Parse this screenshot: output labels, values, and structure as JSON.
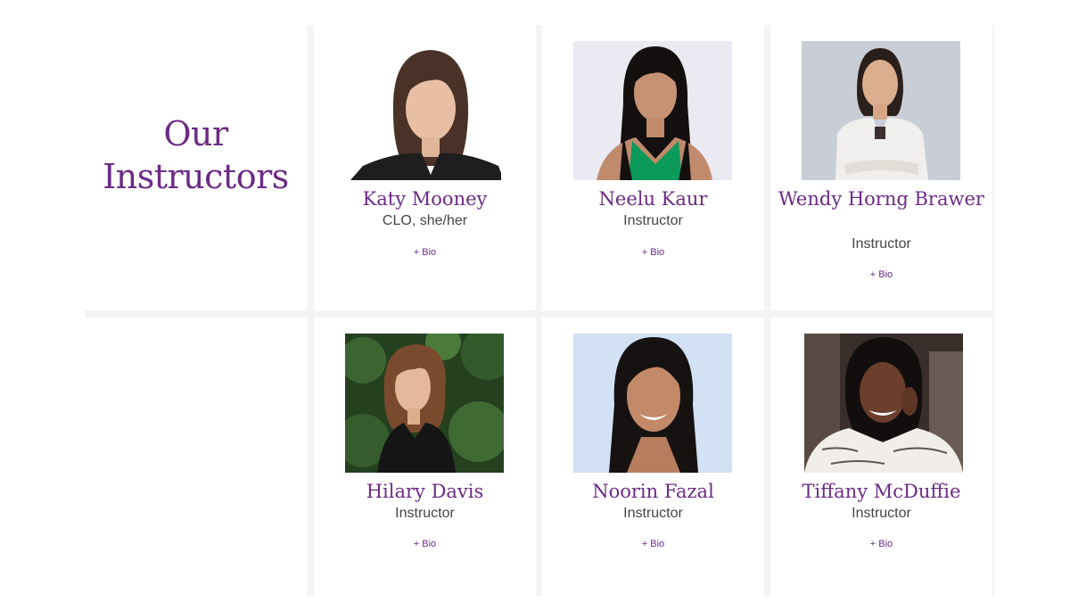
{
  "section": {
    "title_line1": "Our",
    "title_line2": "Instructors"
  },
  "instructors": [
    {
      "name": "Katy Mooney",
      "role": "CLO, she/her",
      "bio_label": "+ Bio"
    },
    {
      "name": "Neelu Kaur",
      "role": "Instructor",
      "bio_label": "+ Bio"
    },
    {
      "name": "Wendy Horng Brawer",
      "role": "Instructor",
      "bio_label": "+ Bio"
    },
    {
      "name": "Hilary Davis",
      "role": "Instructor",
      "bio_label": "+ Bio"
    },
    {
      "name": "Noorin Fazal",
      "role": "Instructor",
      "bio_label": "+ Bio"
    },
    {
      "name": "Tiffany McDuffie",
      "role": "Instructor",
      "bio_label": "+ Bio"
    }
  ],
  "colors": {
    "accent": "#6c2a86",
    "background": "#ffffff",
    "gutter": "#f4f4f4"
  }
}
